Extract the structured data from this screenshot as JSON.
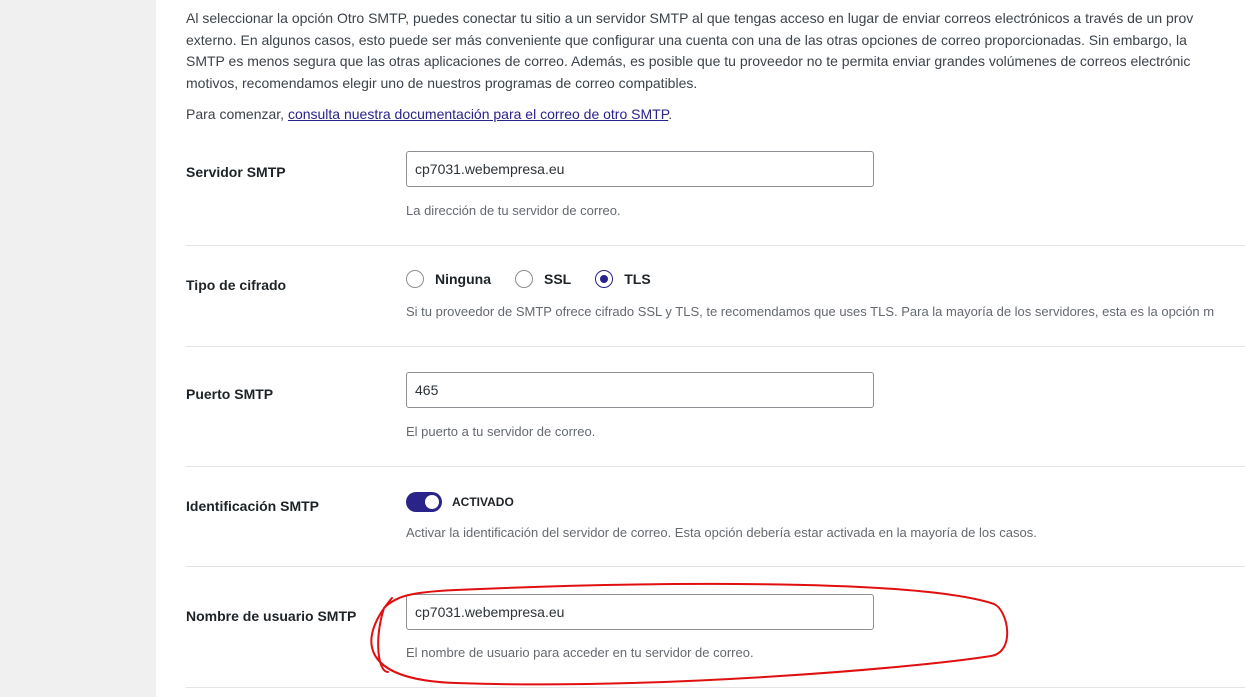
{
  "intro": {
    "line1": "Al seleccionar la opción Otro SMTP, puedes conectar tu sitio a un servidor SMTP al que tengas acceso en lugar de enviar correos electrónicos a través de un prov",
    "line2": "externo. En algunos casos, esto puede ser más conveniente que configurar una cuenta con una de las otras opciones de correo proporcionadas. Sin embargo, la",
    "line3": "SMTP es menos segura que las otras aplicaciones de correo. Además, es posible que tu proveedor no te permita enviar grandes volúmenes de correos electrónic",
    "line4": "motivos, recomendamos elegir uno de nuestros programas de correo compatibles.",
    "start_prefix": "Para comenzar, ",
    "start_link": "consulta nuestra documentación para el correo de otro SMTP",
    "start_suffix": "."
  },
  "smtp_host": {
    "label": "Servidor SMTP",
    "value": "cp7031.webempresa.eu",
    "description": "La dirección de tu servidor de correo."
  },
  "encryption": {
    "label": "Tipo de cifrado",
    "options": [
      "Ninguna",
      "SSL",
      "TLS"
    ],
    "selected": "TLS",
    "description": "Si tu proveedor de SMTP ofrece cifrado SSL y TLS, te recomendamos que uses TLS. Para la mayoría de los servidores, esta es la opción m"
  },
  "smtp_port": {
    "label": "Puerto SMTP",
    "value": "465",
    "description": "El puerto a tu servidor de correo."
  },
  "smtp_auth": {
    "label": "Identificación SMTP",
    "state": "ACTIVADO",
    "enabled": true,
    "description": "Activar la identificación del servidor de correo. Esta opción debería estar activada en la mayoría de los casos."
  },
  "smtp_username": {
    "label": "Nombre de usuario SMTP",
    "value": "cp7031.webempresa.eu",
    "description": "El nombre de usuario para acceder en tu servidor de correo."
  },
  "colors": {
    "accent": "#2a2389",
    "annotation": "#e01010"
  }
}
